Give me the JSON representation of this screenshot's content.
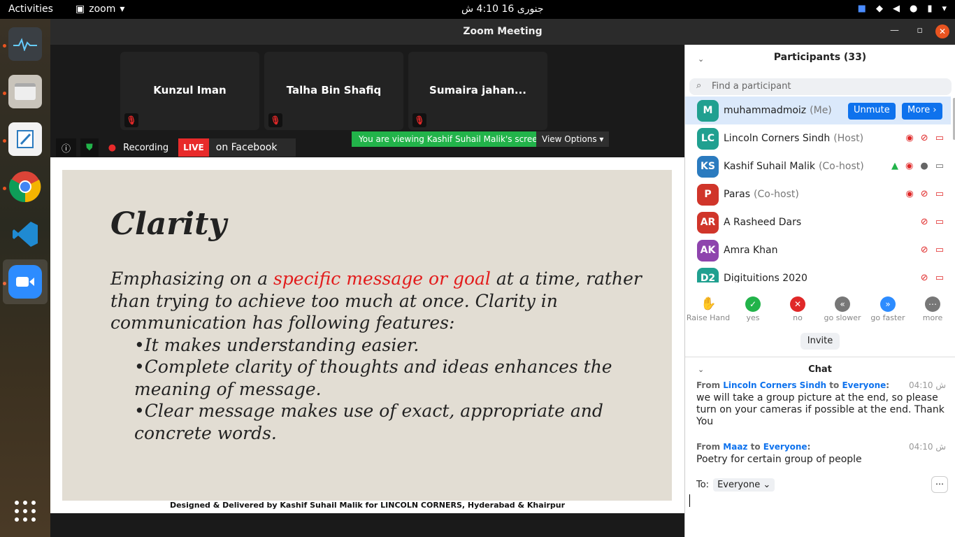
{
  "topbar": {
    "activities": "Activities",
    "app": "zoom",
    "clock": "جنوری 16  4:10 ش"
  },
  "window": {
    "title": "Zoom Meeting"
  },
  "tiles": [
    {
      "name": "Kunzul Iman"
    },
    {
      "name": "Talha Bin Shafiq"
    },
    {
      "name": "Sumaira jahan..."
    }
  ],
  "banner": "You are viewing Kashif Suhail Malik's screen",
  "view_options": "View Options",
  "status": {
    "recording": "Recording",
    "live": "LIVE",
    "facebook": "on Facebook"
  },
  "slide": {
    "title": "Clarity",
    "l1a": "Emphasizing on a ",
    "l1b": "specific message or goal",
    "l1c": " at a time, rather than trying to achieve too much at once. Clarity in communication has following features:",
    "b1": "•It makes understanding easier.",
    "b2": "•Complete clarity of thoughts and ideas enhances the meaning of message.",
    "b3": "•Clear message makes use of exact, appropriate and concrete words.",
    "footer": "Designed & Delivered by Kashif Suhail Malik for LINCOLN CORNERS, Hyderabad & Khairpur"
  },
  "participants": {
    "header": "Participants (33)",
    "search_placeholder": "Find a participant",
    "unmute": "Unmute",
    "more": "More ›",
    "list": [
      {
        "initials": "M",
        "name": "muhammadmoiz",
        "role": "(Me)",
        "color": "#20a090"
      },
      {
        "initials": "LC",
        "name": "Lincoln Corners Sindh",
        "role": "(Host)",
        "color": "#20a090"
      },
      {
        "initials": "KS",
        "name": "Kashif Suhail Malik",
        "role": "(Co-host)",
        "color": "#2b7bbf"
      },
      {
        "initials": "P",
        "name": "Paras",
        "role": "(Co-host)",
        "color": "#d0352a"
      },
      {
        "initials": "AR",
        "name": "A Rasheed Dars",
        "role": "",
        "color": "#d0352a"
      },
      {
        "initials": "AK",
        "name": "Amra Khan",
        "role": "",
        "color": "#8e44ad"
      },
      {
        "initials": "D2",
        "name": "Digituitions 2020",
        "role": "",
        "color": "#20a090"
      }
    ]
  },
  "reactions": [
    {
      "label": "Raise Hand",
      "icon": "✋"
    },
    {
      "label": "yes",
      "icon": "✓"
    },
    {
      "label": "no",
      "icon": "✕"
    },
    {
      "label": "go slower",
      "icon": "«"
    },
    {
      "label": "go faster",
      "icon": "»"
    },
    {
      "label": "more",
      "icon": "⋯"
    }
  ],
  "invite": "Invite",
  "chat": {
    "header": "Chat",
    "to_label": "To:",
    "to_value": "Everyone",
    "messages": [
      {
        "prefix": "From ",
        "from": "Lincoln Corners Sindh",
        "mid": " to ",
        "to": "Everyone",
        "suffix": ":",
        "time": "04:10 ش",
        "text": "we will take a group picture at the end, so please turn on your cameras if possible at the end. Thank You"
      },
      {
        "prefix": "From ",
        "from": "Maaz",
        "mid": " to ",
        "to": "Everyone",
        "suffix": ":",
        "time": "04:10 ش",
        "text": "Poetry for certain group of people"
      }
    ]
  }
}
